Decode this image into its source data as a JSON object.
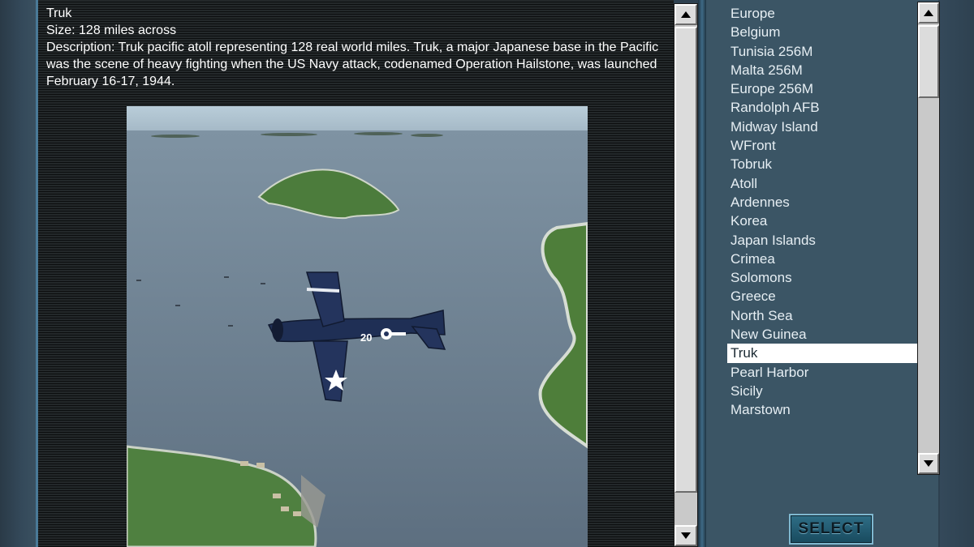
{
  "description": {
    "title": "Truk",
    "size": "Size: 128 miles across",
    "text": "Description: Truk pacific atoll representing 128 real world miles. Truk, a major Japanese base in the Pacific was the scene of heavy fighting when the US Navy attack, codenamed Operation Hailstone, was launched February 16-17, 1944."
  },
  "preview": {
    "plane_marking": "20"
  },
  "maps": [
    "Europe",
    "Belgium",
    "Tunisia 256M",
    "Malta 256M",
    "Europe 256M",
    "Randolph AFB",
    "Midway Island",
    "WFront",
    "Tobruk",
    "Atoll",
    "Ardennes",
    "Korea",
    "Japan Islands",
    "Crimea",
    "Solomons",
    "Greece",
    "North Sea",
    "New Guinea",
    "Truk",
    "Pearl Harbor",
    "Sicily",
    "Marstown"
  ],
  "selected_map": "Truk",
  "select_label": "SELECT",
  "icons": {
    "scroll_up": "arrow-up-icon",
    "scroll_down": "arrow-down-icon"
  }
}
